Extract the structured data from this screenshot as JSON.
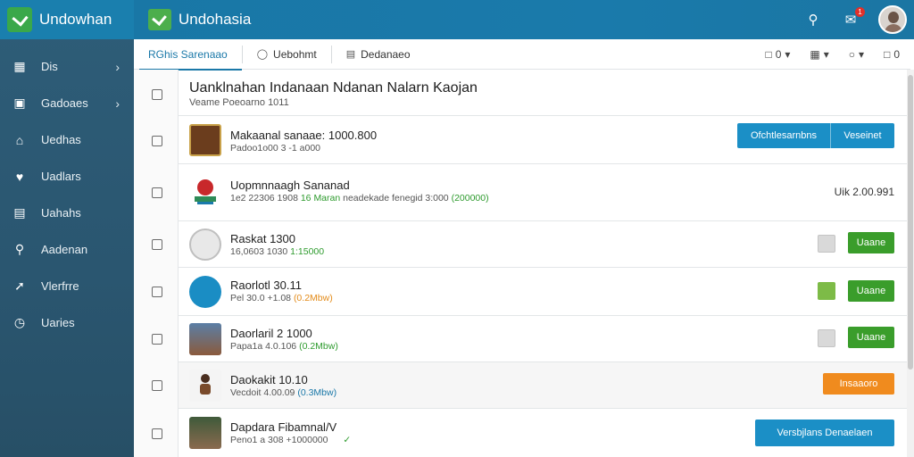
{
  "sidebar": {
    "brand": "Undowhan",
    "items": [
      {
        "label": "Dis",
        "icon": "dashboard-icon",
        "chevron": true
      },
      {
        "label": "Gadoaes",
        "icon": "bag-icon",
        "chevron": true
      },
      {
        "label": "Uedhas",
        "icon": "home-icon",
        "chevron": false
      },
      {
        "label": "Uadlars",
        "icon": "heart-icon",
        "chevron": false
      },
      {
        "label": "Uahahs",
        "icon": "building-icon",
        "chevron": false
      },
      {
        "label": "Aadenan",
        "icon": "search-icon",
        "chevron": false
      },
      {
        "label": "Vlerfrre",
        "icon": "pin-icon",
        "chevron": false
      },
      {
        "label": "Uaries",
        "icon": "clock-icon",
        "chevron": false
      }
    ]
  },
  "topbar": {
    "title": "Undohasia",
    "notification_count": "1"
  },
  "tabs": [
    {
      "label": "RGhis Sarenaao",
      "active": true,
      "icon": ""
    },
    {
      "label": "Uebohmt",
      "active": false,
      "icon": "globe-icon"
    },
    {
      "label": "Dedanaeo",
      "active": false,
      "icon": "tag-icon"
    }
  ],
  "toolbar": {
    "tool1": "0",
    "tool2": "",
    "tool3": "",
    "tool4": "0"
  },
  "header": {
    "title": "Uanklnahan Indanaan Ndanan Nalarn Kaojan",
    "subtitle": "Veame   Poeoarno   1011"
  },
  "rows": [
    {
      "title": "Makaanal sanaae: 1000.800",
      "sub": "Padoo1o00 3 -1 a000",
      "tag": "",
      "tag_color": "",
      "action": "split",
      "action_label": "Ofchtlesarnbns",
      "action_label2": "Veseinet",
      "price": ""
    },
    {
      "title": "Uopmnnaagh Sananad",
      "sub": "1e2 22306 1908",
      "tag": "16 Maran",
      "tag_color": "g",
      "sub2": "neadekade fenegid 3:000",
      "tag2": "(200000)",
      "action": "price",
      "price": "Uik 2.00.991"
    },
    {
      "title": "Raskat 1300",
      "sub": "16,0603 1030",
      "tag": "1:15000",
      "tag_color": "g",
      "action": "green-with-sq",
      "action_label": "Uaane",
      "sq": "grey"
    },
    {
      "title": "Raorlotl 30.11",
      "sub": "Pel 30.0 +1.08",
      "tag": "(0.2Mbw)",
      "tag_color": "o",
      "action": "green-with-sq",
      "action_label": "Uaane",
      "sq": "green"
    },
    {
      "title": "Daorlaril 2 1000",
      "sub": "Papa1a 4.0.106",
      "tag": "(0.2Mbw)",
      "tag_color": "g",
      "action": "green-with-sq",
      "action_label": "Uaane",
      "sq": "grey"
    },
    {
      "title": "Daokakit 10.10",
      "sub": "Vecdoit 4.00.09",
      "tag": "(0.3Mbw)",
      "tag_color": "b",
      "action": "orange",
      "action_label": "Insaaoro"
    },
    {
      "title": "Dapdara Fibamnal/V",
      "sub": "Peno1 a 308 +1000000",
      "tag": "✓",
      "tag_color": "g",
      "action": "blue",
      "action_label": "Versbjlans Denaelaen"
    }
  ],
  "colors": {
    "topbar": "#1a7aab",
    "sidebar": "#2a5670",
    "accent_blue": "#1b8fc6",
    "accent_green": "#3a9d2b",
    "accent_orange": "#f08b1e"
  }
}
